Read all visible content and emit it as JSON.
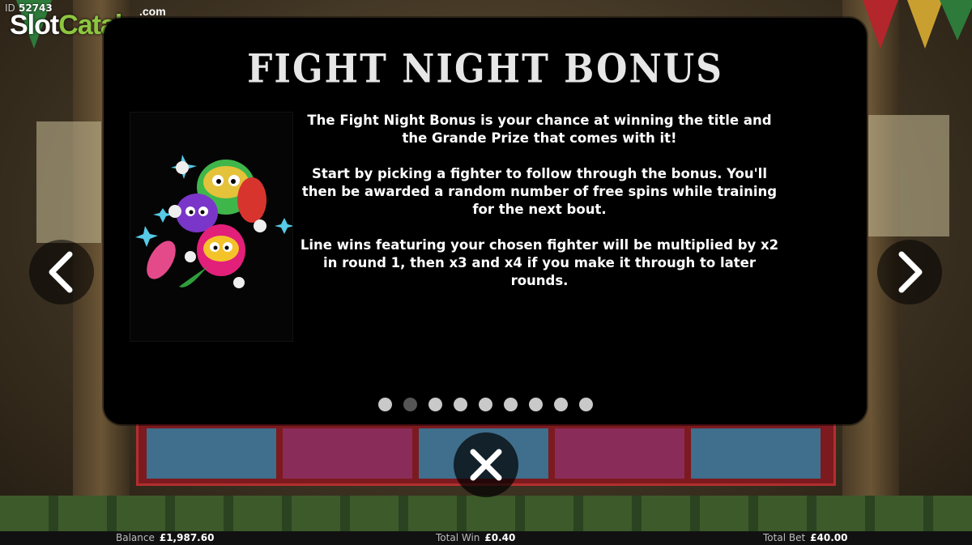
{
  "watermark": {
    "id_prefix": "ID",
    "id_value": "52743",
    "logo_slot": "Slot",
    "logo_catalog": "Catalog",
    "logo_com": ".com"
  },
  "paytable": {
    "title": "Fight Night Bonus",
    "paragraphs": [
      "The Fight Night Bonus is your chance at winning the title and the Grande Prize that comes with it!",
      "Start by picking a fighter to follow through the bonus. You'll then be awarded a random number of free spins while training for the next bout.",
      "Line wins featuring your chosen fighter will be multiplied by x2 in round 1, then x3 and x4 if you make it through to later rounds."
    ],
    "page_count": 9,
    "active_page": 2
  },
  "status_bar": {
    "balance_label": "Balance",
    "balance_value": "£1,987.60",
    "total_win_label": "Total Win",
    "total_win_value": "£0.40",
    "total_bet_label": "Total Bet",
    "total_bet_value": "£40.00"
  },
  "icons": {
    "prev": "chevron-left-icon",
    "next": "chevron-right-icon",
    "close": "close-icon"
  },
  "colors": {
    "panel_bg": "#000000",
    "logo_green": "#8dc63f",
    "dot_inactive": "#c9c9c9",
    "dot_active": "#555555"
  }
}
